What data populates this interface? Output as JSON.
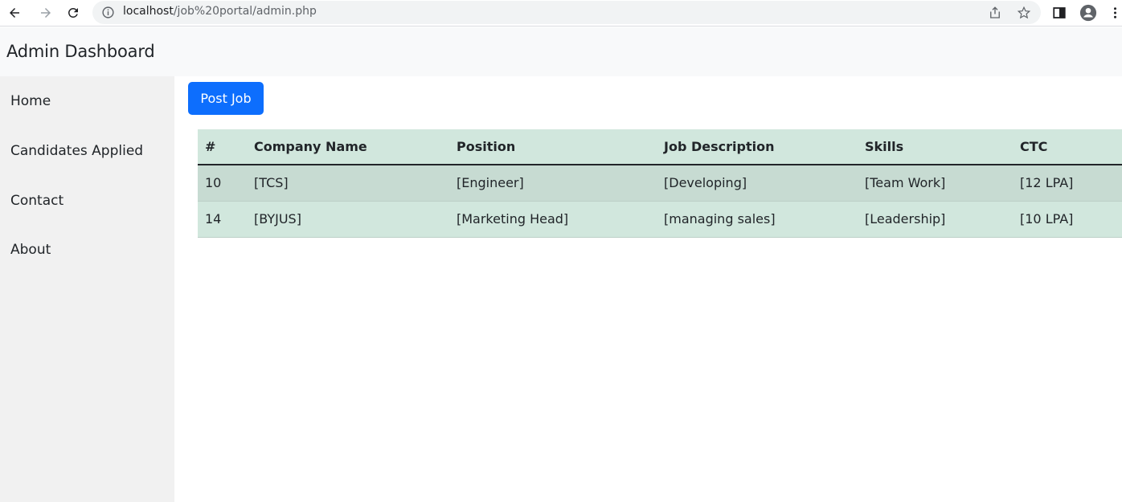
{
  "browser": {
    "url_host": "localhost",
    "url_path": "/job%20portal/admin.php"
  },
  "header": {
    "title": "Admin Dashboard"
  },
  "sidebar": {
    "items": [
      {
        "label": "Home"
      },
      {
        "label": "Candidates Applied"
      },
      {
        "label": "Contact"
      },
      {
        "label": "About"
      }
    ]
  },
  "main": {
    "post_job_label": "Post Job",
    "table": {
      "headers": [
        "#",
        "Company Name",
        "Position",
        "Job Description",
        "Skills",
        "CTC"
      ],
      "rows": [
        [
          "10",
          "[TCS]",
          "[Engineer]",
          "[Developing]",
          "[Team Work]",
          "[12 LPA]"
        ],
        [
          "14",
          "[BYJUS]",
          "[Marketing Head]",
          "[managing sales]",
          "[Leadership]",
          "[10 LPA]"
        ]
      ]
    }
  },
  "colors": {
    "primary_button": "#0d6efd",
    "table_bg": "#d1e7dd",
    "table_striped": "#c7dbd2",
    "sidebar_bg": "#f1f1f1"
  }
}
